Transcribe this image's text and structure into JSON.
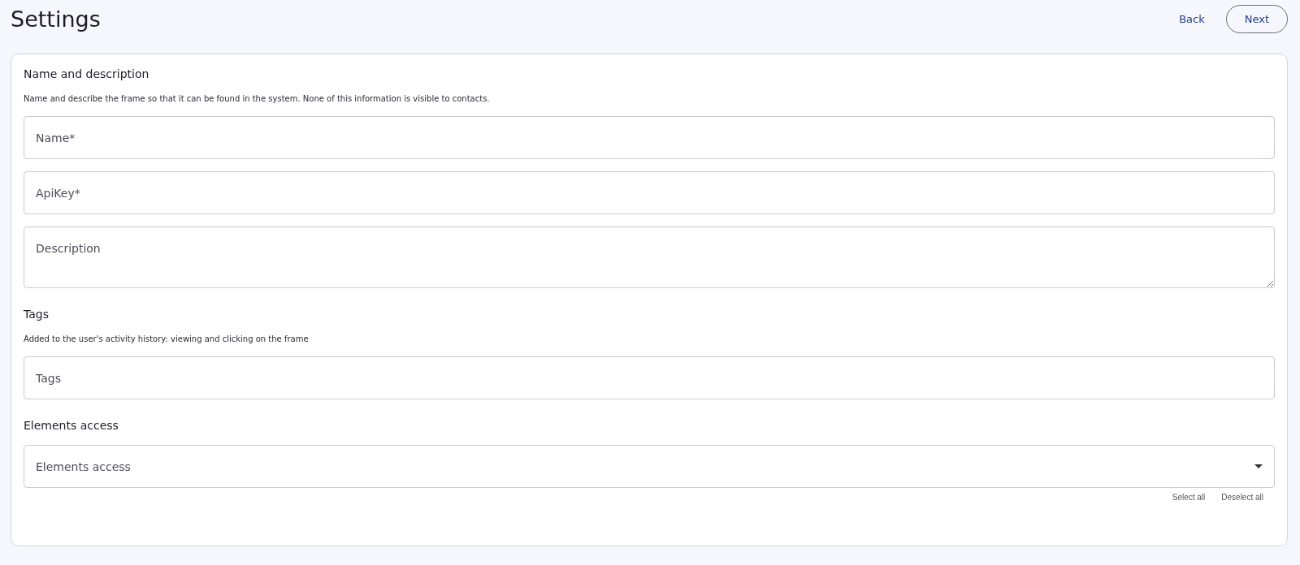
{
  "title": "Settings",
  "nav": [
    {
      "label": "Back",
      "kind": "link"
    },
    {
      "label": "Next",
      "kind": "outlined"
    }
  ],
  "sections": [
    {
      "heading": "Name and description",
      "description": "Name and describe the frame so that it can be found in the system. None of this information is visible to contacts.",
      "fields": [
        {
          "kind": "input",
          "placeholder": "Name*"
        },
        {
          "kind": "input",
          "placeholder": "ApiKey*"
        },
        {
          "kind": "textarea",
          "placeholder": "Description"
        }
      ]
    },
    {
      "heading": "Tags",
      "description": "Added to the user's activity history: viewing and clicking on the frame",
      "fields": [
        {
          "kind": "input",
          "placeholder": "Tags"
        }
      ]
    },
    {
      "heading": "Elements access",
      "fields": [
        {
          "kind": "select",
          "placeholder": "Elements access"
        }
      ],
      "actions": [
        "Select all",
        "Deselect all"
      ]
    }
  ]
}
